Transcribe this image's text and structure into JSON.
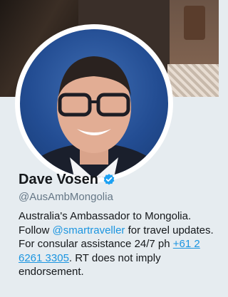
{
  "profile": {
    "name": "Dave Vosen",
    "handle": "@AusAmbMongolia",
    "bio": {
      "line1": "Australia's Ambassador to Mongolia.",
      "follow_prefix": "Follow ",
      "mention": "@smartraveller",
      "follow_suffix": " for travel updates.",
      "consular_prefix": "For consular assistance 24/7 ph ",
      "phone_part1": "+61 2",
      "phone_part2": "6261 3305",
      "suffix": ". RT does not imply",
      "last_line": "endorsement."
    }
  },
  "icons": {
    "verified": "verified-badge-icon",
    "verified_color": "#1da1f2"
  },
  "colors": {
    "link": "#1b95e0",
    "background": "#e6ecf0"
  }
}
